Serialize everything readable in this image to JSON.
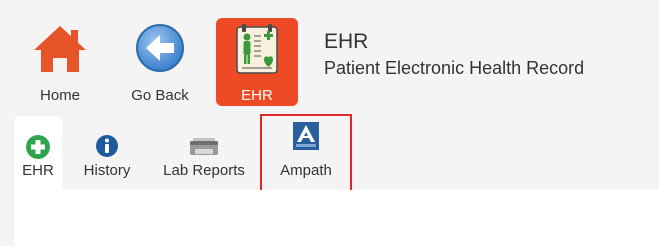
{
  "toolbar": {
    "home_label": "Home",
    "back_label": "Go Back",
    "ehr_label": "EHR"
  },
  "header": {
    "title": "EHR",
    "subtitle": "Patient Electronic Health Record"
  },
  "tabs": [
    {
      "label": "EHR",
      "icon": "plus-circle-icon",
      "active": true
    },
    {
      "label": "History",
      "icon": "info-circle-icon",
      "active": false
    },
    {
      "label": "Lab Reports",
      "icon": "printer-icon",
      "active": false
    },
    {
      "label": "Ampath",
      "icon": "ampath-logo-icon",
      "active": false,
      "highlighted": true
    }
  ],
  "colors": {
    "accent": "#ee4a25",
    "home_icon": "#e8542a",
    "back_icon": "#4a8fd6",
    "ehr_tab_icon": "#2ea44f",
    "info_icon": "#1f5a9c",
    "highlight_border": "#e0262b",
    "background": "#f4f4f4"
  }
}
